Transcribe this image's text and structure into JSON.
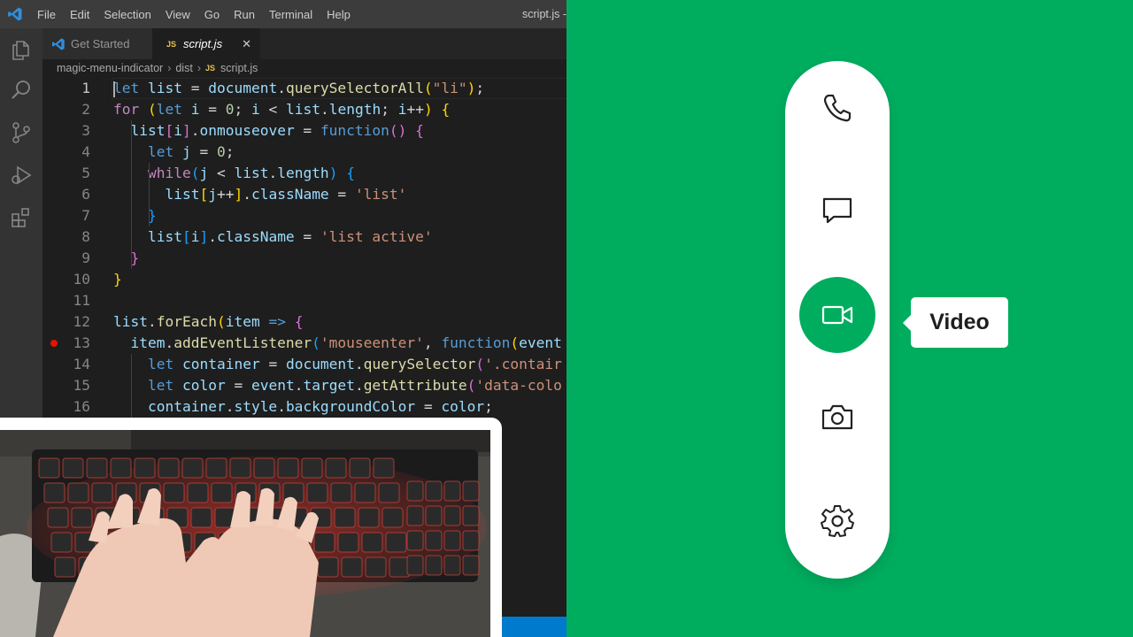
{
  "colors": {
    "preview_background": "#00ad5f",
    "menu_active": "#00ad5f",
    "editor_background": "#1e1e1e",
    "statusbar": "#007acc",
    "breakpoint": "#e51400"
  },
  "titlebar": {
    "menu": [
      "File",
      "Edit",
      "Selection",
      "View",
      "Go",
      "Run",
      "Terminal",
      "Help"
    ],
    "window_title": "script.js -"
  },
  "activity_bar": {
    "icons": [
      "explorer-icon",
      "search-icon",
      "source-control-icon",
      "run-debug-icon",
      "extensions-icon"
    ]
  },
  "tabs": [
    {
      "label": "Get Started",
      "icon": "vscode-icon",
      "active": false
    },
    {
      "label": "script.js",
      "badge": "JS",
      "active": true,
      "close_glyph": "✕"
    }
  ],
  "breadcrumb": {
    "folder": "magic-menu-indicator",
    "subfolder": "dist",
    "badge": "JS",
    "file": "script.js",
    "separator": "›"
  },
  "editor": {
    "current_line": 1,
    "breakpoint_line": 13,
    "lines": [
      {
        "n": "1",
        "tokens": [
          [
            "k",
            "let"
          ],
          [
            "p",
            " "
          ],
          [
            "v",
            "list"
          ],
          [
            "p",
            " = "
          ],
          [
            "v",
            "document"
          ],
          [
            "p",
            "."
          ],
          [
            "f",
            "querySelectorAll"
          ],
          [
            "b1",
            "("
          ],
          [
            "s",
            "\"li\""
          ],
          [
            "b1",
            ")"
          ],
          [
            "p",
            ";"
          ]
        ]
      },
      {
        "n": "2",
        "tokens": [
          [
            "c",
            "for"
          ],
          [
            "p",
            " "
          ],
          [
            "b1",
            "("
          ],
          [
            "k",
            "let"
          ],
          [
            "p",
            " "
          ],
          [
            "v",
            "i"
          ],
          [
            "p",
            " = "
          ],
          [
            "n",
            "0"
          ],
          [
            "p",
            "; "
          ],
          [
            "v",
            "i"
          ],
          [
            "p",
            " < "
          ],
          [
            "v",
            "list"
          ],
          [
            "p",
            "."
          ],
          [
            "v",
            "length"
          ],
          [
            "p",
            "; "
          ],
          [
            "v",
            "i"
          ],
          [
            "p",
            "++"
          ],
          [
            "b1",
            ")"
          ],
          [
            "p",
            " "
          ],
          [
            "b1",
            "{"
          ]
        ]
      },
      {
        "n": "3",
        "tokens": [
          [
            "p",
            "  "
          ],
          [
            "v",
            "list"
          ],
          [
            "b2",
            "["
          ],
          [
            "v",
            "i"
          ],
          [
            "b2",
            "]"
          ],
          [
            "p",
            "."
          ],
          [
            "v",
            "onmouseover"
          ],
          [
            "p",
            " = "
          ],
          [
            "k",
            "function"
          ],
          [
            "b2",
            "()"
          ],
          [
            "p",
            " "
          ],
          [
            "b2",
            "{"
          ]
        ]
      },
      {
        "n": "4",
        "tokens": [
          [
            "p",
            "    "
          ],
          [
            "k",
            "let"
          ],
          [
            "p",
            " "
          ],
          [
            "v",
            "j"
          ],
          [
            "p",
            " = "
          ],
          [
            "n",
            "0"
          ],
          [
            "p",
            ";"
          ]
        ]
      },
      {
        "n": "5",
        "tokens": [
          [
            "p",
            "    "
          ],
          [
            "c",
            "while"
          ],
          [
            "b3",
            "("
          ],
          [
            "v",
            "j"
          ],
          [
            "p",
            " < "
          ],
          [
            "v",
            "list"
          ],
          [
            "p",
            "."
          ],
          [
            "v",
            "length"
          ],
          [
            "b3",
            ")"
          ],
          [
            "p",
            " "
          ],
          [
            "b3",
            "{"
          ]
        ]
      },
      {
        "n": "6",
        "tokens": [
          [
            "p",
            "      "
          ],
          [
            "v",
            "list"
          ],
          [
            "b1",
            "["
          ],
          [
            "v",
            "j"
          ],
          [
            "p",
            "++"
          ],
          [
            "b1",
            "]"
          ],
          [
            "p",
            "."
          ],
          [
            "v",
            "className"
          ],
          [
            "p",
            " = "
          ],
          [
            "s",
            "'list'"
          ]
        ]
      },
      {
        "n": "7",
        "tokens": [
          [
            "p",
            "    "
          ],
          [
            "b3",
            "}"
          ]
        ]
      },
      {
        "n": "8",
        "tokens": [
          [
            "p",
            "    "
          ],
          [
            "v",
            "list"
          ],
          [
            "b3",
            "["
          ],
          [
            "v",
            "i"
          ],
          [
            "b3",
            "]"
          ],
          [
            "p",
            "."
          ],
          [
            "v",
            "className"
          ],
          [
            "p",
            " = "
          ],
          [
            "s",
            "'list active'"
          ]
        ]
      },
      {
        "n": "9",
        "tokens": [
          [
            "p",
            "  "
          ],
          [
            "b2",
            "}"
          ]
        ]
      },
      {
        "n": "10",
        "tokens": [
          [
            "b1",
            "}"
          ]
        ]
      },
      {
        "n": "11",
        "tokens": []
      },
      {
        "n": "12",
        "tokens": [
          [
            "v",
            "list"
          ],
          [
            "p",
            "."
          ],
          [
            "f",
            "forEach"
          ],
          [
            "b1",
            "("
          ],
          [
            "v",
            "item"
          ],
          [
            "p",
            " "
          ],
          [
            "k",
            "=>"
          ],
          [
            "p",
            " "
          ],
          [
            "b2",
            "{"
          ]
        ]
      },
      {
        "n": "13",
        "tokens": [
          [
            "p",
            "  "
          ],
          [
            "v",
            "item"
          ],
          [
            "p",
            "."
          ],
          [
            "f",
            "addEventListener"
          ],
          [
            "b3",
            "("
          ],
          [
            "s",
            "'mouseenter'"
          ],
          [
            "p",
            ", "
          ],
          [
            "k",
            "function"
          ],
          [
            "b1",
            "("
          ],
          [
            "v",
            "event"
          ]
        ]
      },
      {
        "n": "14",
        "tokens": [
          [
            "p",
            "    "
          ],
          [
            "k",
            "let"
          ],
          [
            "p",
            " "
          ],
          [
            "v",
            "container"
          ],
          [
            "p",
            " = "
          ],
          [
            "v",
            "document"
          ],
          [
            "p",
            "."
          ],
          [
            "f",
            "querySelector"
          ],
          [
            "b2",
            "("
          ],
          [
            "s",
            "'.contair"
          ]
        ]
      },
      {
        "n": "15",
        "tokens": [
          [
            "p",
            "    "
          ],
          [
            "k",
            "let"
          ],
          [
            "p",
            " "
          ],
          [
            "v",
            "color"
          ],
          [
            "p",
            " = "
          ],
          [
            "v",
            "event"
          ],
          [
            "p",
            "."
          ],
          [
            "v",
            "target"
          ],
          [
            "p",
            "."
          ],
          [
            "f",
            "getAttribute"
          ],
          [
            "b2",
            "("
          ],
          [
            "s",
            "'data-colo"
          ]
        ]
      },
      {
        "n": "16",
        "tokens": [
          [
            "p",
            "    "
          ],
          [
            "v",
            "container"
          ],
          [
            "p",
            "."
          ],
          [
            "v",
            "style"
          ],
          [
            "p",
            "."
          ],
          [
            "v",
            "backgroundColor"
          ],
          [
            "p",
            " = "
          ],
          [
            "v",
            "color"
          ],
          [
            "p",
            ";"
          ]
        ]
      }
    ]
  },
  "menu": {
    "items": [
      {
        "key": "phone",
        "icon": "phone-icon",
        "active": false
      },
      {
        "key": "message",
        "icon": "message-icon",
        "active": false
      },
      {
        "key": "video",
        "icon": "video-icon",
        "active": true
      },
      {
        "key": "camera",
        "icon": "camera-icon",
        "active": false
      },
      {
        "key": "settings",
        "icon": "settings-icon",
        "active": false
      }
    ],
    "tooltip": "Video"
  },
  "webcam": {
    "content": "keyboard-typing-video"
  }
}
